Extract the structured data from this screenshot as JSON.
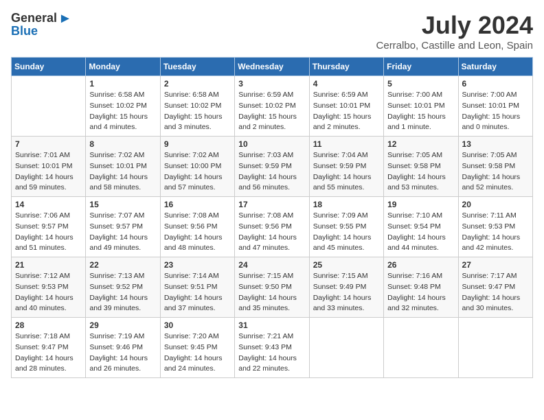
{
  "header": {
    "logo_general": "General",
    "logo_blue": "Blue",
    "title": "July 2024",
    "subtitle": "Cerralbo, Castille and Leon, Spain"
  },
  "days_of_week": [
    "Sunday",
    "Monday",
    "Tuesday",
    "Wednesday",
    "Thursday",
    "Friday",
    "Saturday"
  ],
  "weeks": [
    [
      {
        "day": "",
        "info": ""
      },
      {
        "day": "1",
        "info": "Sunrise: 6:58 AM\nSunset: 10:02 PM\nDaylight: 15 hours\nand 4 minutes."
      },
      {
        "day": "2",
        "info": "Sunrise: 6:58 AM\nSunset: 10:02 PM\nDaylight: 15 hours\nand 3 minutes."
      },
      {
        "day": "3",
        "info": "Sunrise: 6:59 AM\nSunset: 10:02 PM\nDaylight: 15 hours\nand 2 minutes."
      },
      {
        "day": "4",
        "info": "Sunrise: 6:59 AM\nSunset: 10:01 PM\nDaylight: 15 hours\nand 2 minutes."
      },
      {
        "day": "5",
        "info": "Sunrise: 7:00 AM\nSunset: 10:01 PM\nDaylight: 15 hours\nand 1 minute."
      },
      {
        "day": "6",
        "info": "Sunrise: 7:00 AM\nSunset: 10:01 PM\nDaylight: 15 hours\nand 0 minutes."
      }
    ],
    [
      {
        "day": "7",
        "info": "Sunrise: 7:01 AM\nSunset: 10:01 PM\nDaylight: 14 hours\nand 59 minutes."
      },
      {
        "day": "8",
        "info": "Sunrise: 7:02 AM\nSunset: 10:01 PM\nDaylight: 14 hours\nand 58 minutes."
      },
      {
        "day": "9",
        "info": "Sunrise: 7:02 AM\nSunset: 10:00 PM\nDaylight: 14 hours\nand 57 minutes."
      },
      {
        "day": "10",
        "info": "Sunrise: 7:03 AM\nSunset: 9:59 PM\nDaylight: 14 hours\nand 56 minutes."
      },
      {
        "day": "11",
        "info": "Sunrise: 7:04 AM\nSunset: 9:59 PM\nDaylight: 14 hours\nand 55 minutes."
      },
      {
        "day": "12",
        "info": "Sunrise: 7:05 AM\nSunset: 9:58 PM\nDaylight: 14 hours\nand 53 minutes."
      },
      {
        "day": "13",
        "info": "Sunrise: 7:05 AM\nSunset: 9:58 PM\nDaylight: 14 hours\nand 52 minutes."
      }
    ],
    [
      {
        "day": "14",
        "info": "Sunrise: 7:06 AM\nSunset: 9:57 PM\nDaylight: 14 hours\nand 51 minutes."
      },
      {
        "day": "15",
        "info": "Sunrise: 7:07 AM\nSunset: 9:57 PM\nDaylight: 14 hours\nand 49 minutes."
      },
      {
        "day": "16",
        "info": "Sunrise: 7:08 AM\nSunset: 9:56 PM\nDaylight: 14 hours\nand 48 minutes."
      },
      {
        "day": "17",
        "info": "Sunrise: 7:08 AM\nSunset: 9:56 PM\nDaylight: 14 hours\nand 47 minutes."
      },
      {
        "day": "18",
        "info": "Sunrise: 7:09 AM\nSunset: 9:55 PM\nDaylight: 14 hours\nand 45 minutes."
      },
      {
        "day": "19",
        "info": "Sunrise: 7:10 AM\nSunset: 9:54 PM\nDaylight: 14 hours\nand 44 minutes."
      },
      {
        "day": "20",
        "info": "Sunrise: 7:11 AM\nSunset: 9:53 PM\nDaylight: 14 hours\nand 42 minutes."
      }
    ],
    [
      {
        "day": "21",
        "info": "Sunrise: 7:12 AM\nSunset: 9:53 PM\nDaylight: 14 hours\nand 40 minutes."
      },
      {
        "day": "22",
        "info": "Sunrise: 7:13 AM\nSunset: 9:52 PM\nDaylight: 14 hours\nand 39 minutes."
      },
      {
        "day": "23",
        "info": "Sunrise: 7:14 AM\nSunset: 9:51 PM\nDaylight: 14 hours\nand 37 minutes."
      },
      {
        "day": "24",
        "info": "Sunrise: 7:15 AM\nSunset: 9:50 PM\nDaylight: 14 hours\nand 35 minutes."
      },
      {
        "day": "25",
        "info": "Sunrise: 7:15 AM\nSunset: 9:49 PM\nDaylight: 14 hours\nand 33 minutes."
      },
      {
        "day": "26",
        "info": "Sunrise: 7:16 AM\nSunset: 9:48 PM\nDaylight: 14 hours\nand 32 minutes."
      },
      {
        "day": "27",
        "info": "Sunrise: 7:17 AM\nSunset: 9:47 PM\nDaylight: 14 hours\nand 30 minutes."
      }
    ],
    [
      {
        "day": "28",
        "info": "Sunrise: 7:18 AM\nSunset: 9:47 PM\nDaylight: 14 hours\nand 28 minutes."
      },
      {
        "day": "29",
        "info": "Sunrise: 7:19 AM\nSunset: 9:46 PM\nDaylight: 14 hours\nand 26 minutes."
      },
      {
        "day": "30",
        "info": "Sunrise: 7:20 AM\nSunset: 9:45 PM\nDaylight: 14 hours\nand 24 minutes."
      },
      {
        "day": "31",
        "info": "Sunrise: 7:21 AM\nSunset: 9:43 PM\nDaylight: 14 hours\nand 22 minutes."
      },
      {
        "day": "",
        "info": ""
      },
      {
        "day": "",
        "info": ""
      },
      {
        "day": "",
        "info": ""
      }
    ]
  ]
}
